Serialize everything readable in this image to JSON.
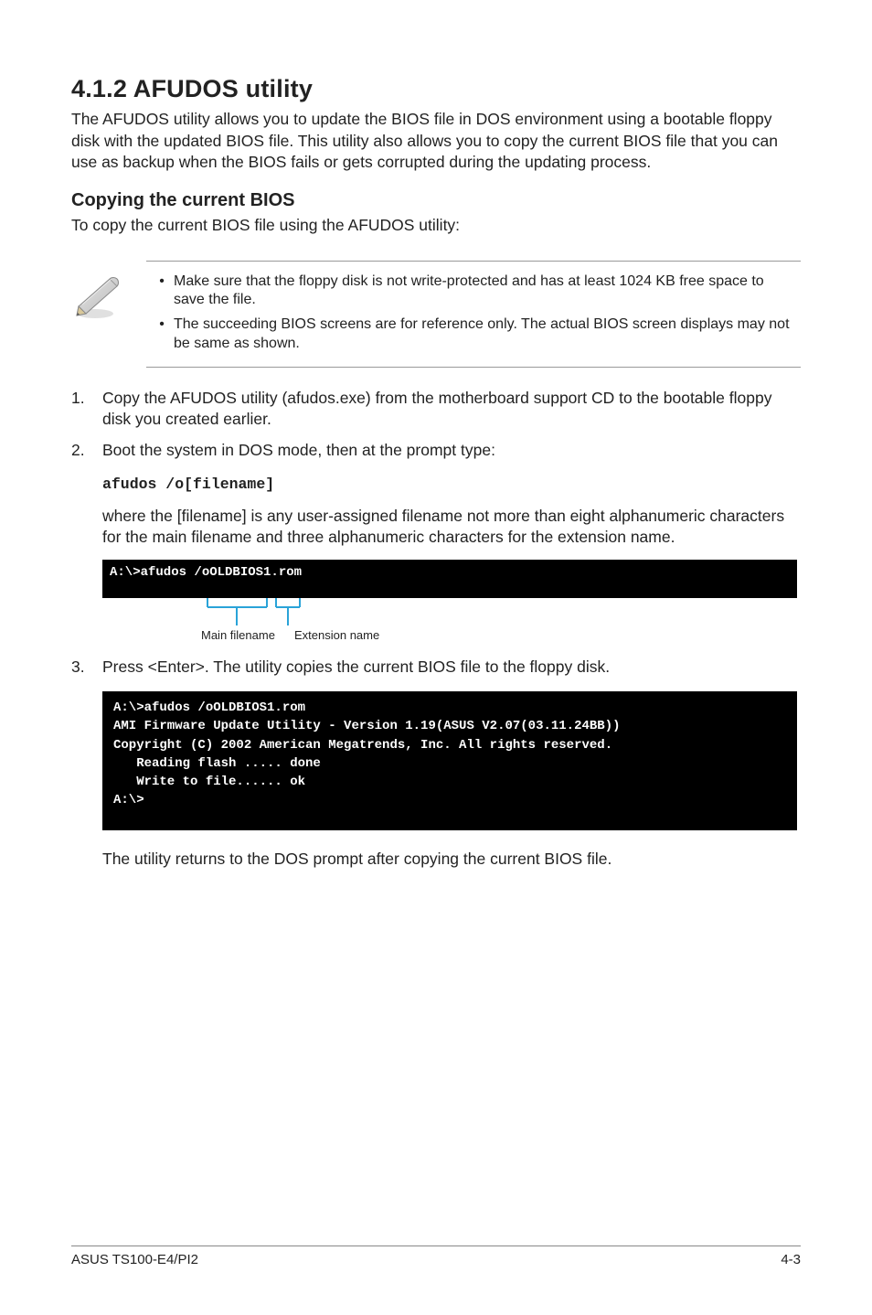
{
  "section": {
    "title": "4.1.2 AFUDOS utility",
    "intro": "The AFUDOS utility allows you to update the BIOS file in DOS environment using a bootable floppy disk with the updated BIOS file. This utility also allows you to copy the current BIOS file that you can use as backup when the BIOS fails or gets corrupted during the updating process."
  },
  "sub": {
    "title": "Copying the current BIOS",
    "lead": "To copy the current BIOS file using the AFUDOS utility:"
  },
  "note": {
    "items": [
      "Make sure that the floppy disk is not write-protected and has at least 1024 KB free space to save the file.",
      "The succeeding BIOS screens are for reference only. The actual BIOS screen displays may not be same as shown."
    ]
  },
  "steps": {
    "s1": "Copy the AFUDOS utility (afudos.exe) from the motherboard support CD to the bootable floppy disk you created earlier.",
    "s2": "Boot the system in DOS mode, then at the prompt type:",
    "s2_code": "afudos /o[filename]",
    "s2_explain": "where the [filename] is any user-assigned filename not more than eight alphanumeric characters for the main filename and three alphanumeric characters for the extension name.",
    "s3": "Press <Enter>. The utility copies the current BIOS file to the floppy disk."
  },
  "term1": {
    "line": "A:\\>afudos /oOLDBIOS1.rom",
    "label_main": "Main filename",
    "label_ext": "Extension name"
  },
  "term2": {
    "l1": "A:\\>afudos /oOLDBIOS1.rom",
    "l2": "AMI Firmware Update Utility - Version 1.19(ASUS V2.07(03.11.24BB))",
    "l3": "Copyright (C) 2002 American Megatrends, Inc. All rights reserved.",
    "l4": "   Reading flash ..... done",
    "l5": "   Write to file...... ok",
    "l6": "A:\\>"
  },
  "after": "The utility returns to the DOS prompt after copying the current BIOS file.",
  "footer": {
    "left": "ASUS TS100-E4/PI2",
    "right": "4-3"
  }
}
